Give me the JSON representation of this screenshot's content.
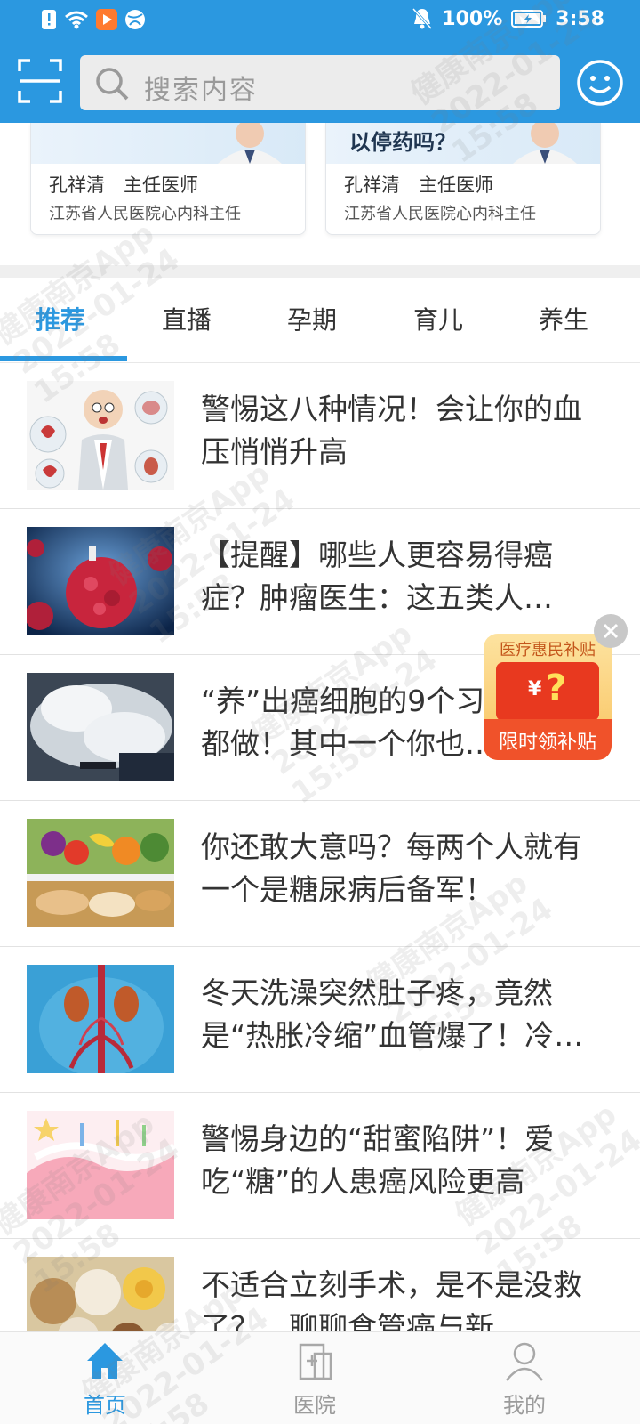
{
  "status_bar": {
    "battery": "100%",
    "time": "3:58",
    "colors": {
      "bar": "#2b98e0"
    }
  },
  "header": {
    "search_placeholder": "搜索内容",
    "scan_icon": "scan-icon",
    "chat_icon": "smiley-chat-icon"
  },
  "doctor_cards": [
    {
      "banner_text": "",
      "name": "孔祥清　主任医师",
      "hospital": "江苏省人民医院心内科主任"
    },
    {
      "banner_text": "以停药吗？",
      "name": "孔祥清　主任医师",
      "hospital": "江苏省人民医院心内科主任"
    }
  ],
  "tabs": [
    {
      "label": "推荐",
      "active": true
    },
    {
      "label": "直播"
    },
    {
      "label": "孕期"
    },
    {
      "label": "育儿"
    },
    {
      "label": "养生"
    }
  ],
  "articles": [
    {
      "title": "警惕这八种情况！会让你的血压悄悄升高"
    },
    {
      "title": "【提醒】哪些人更容易得癌症？肿瘤医生：这五类人…"
    },
    {
      "title": "“养”出癌细胞的9个习惯，每天都做！其中一个你也…"
    },
    {
      "title": "你还敢大意吗？每两个人就有一个是糖尿病后备军！"
    },
    {
      "title": "冬天洗澡突然肚子疼，竟然是“热胀冷缩”血管爆了！冷…"
    },
    {
      "title": "警惕身边的“甜蜜陷阱”！爱吃“糖”的人患癌风险更高"
    },
    {
      "title": "不适合立刻手术，是不是没救了？…聊聊食管癌与新…"
    }
  ],
  "promo": {
    "top_text": "医疗惠民补贴",
    "currency": "¥",
    "mark": "?",
    "bottom_text": "限时领补贴"
  },
  "bottom_nav": [
    {
      "label": "首页",
      "icon": "home-icon",
      "active": true
    },
    {
      "label": "医院",
      "icon": "hospital-icon"
    },
    {
      "label": "我的",
      "icon": "profile-icon"
    }
  ],
  "watermark": "健康南京App\n2022-01-24\n15:58"
}
